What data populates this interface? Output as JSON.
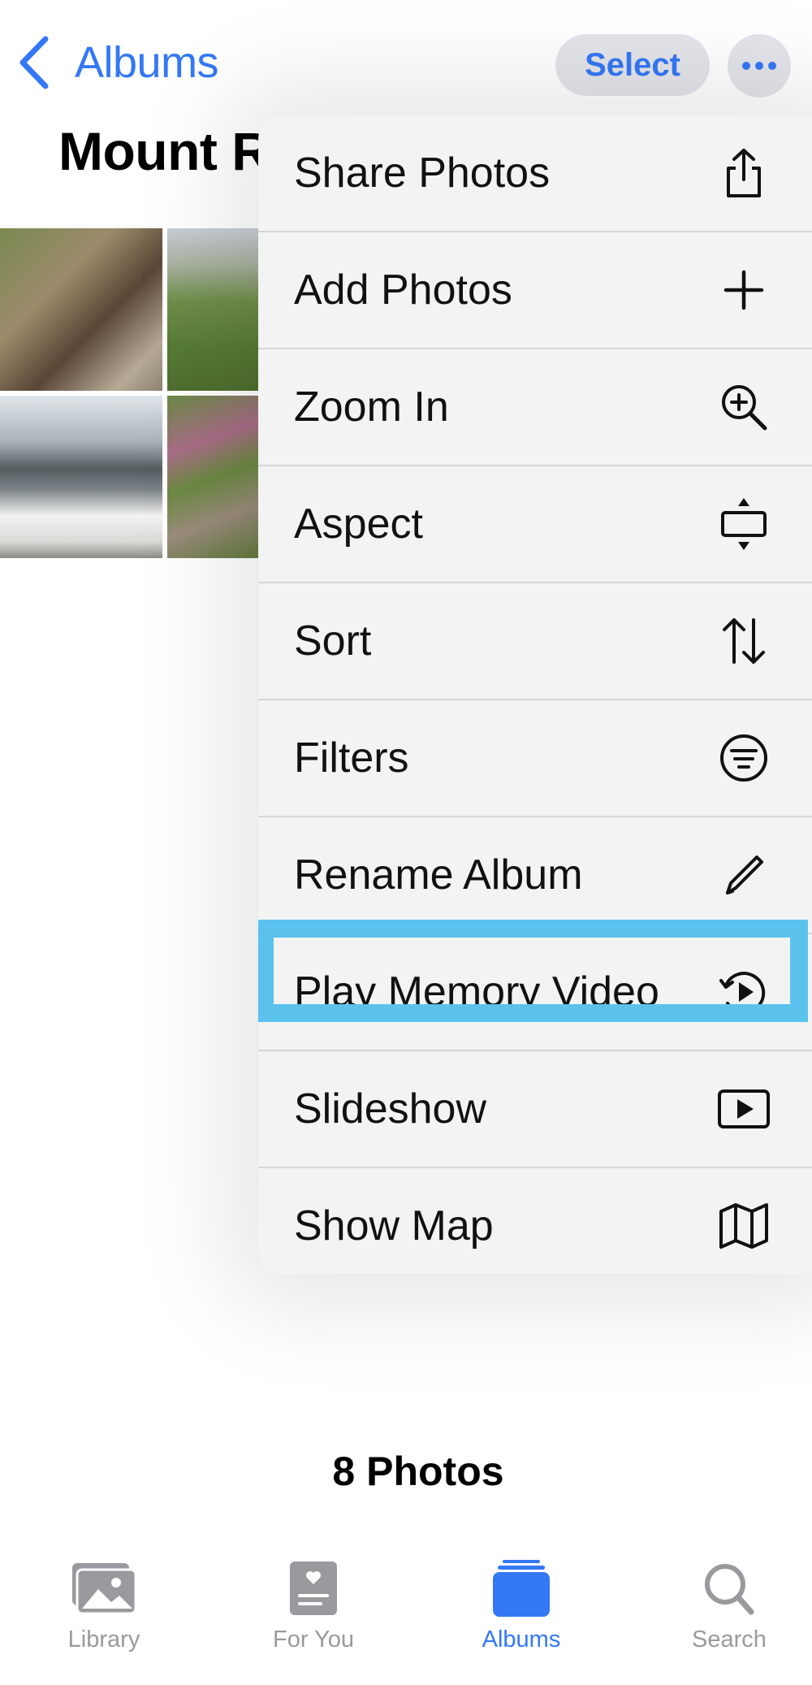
{
  "header": {
    "back_label": "Albums",
    "select_label": "Select",
    "album_title": "Mount R"
  },
  "menu": {
    "items": [
      {
        "label": "Share Photos",
        "icon": "share-icon"
      },
      {
        "label": "Add Photos",
        "icon": "plus-icon"
      },
      {
        "label": "Zoom In",
        "icon": "zoom-in-icon"
      },
      {
        "label": "Aspect",
        "icon": "aspect-icon"
      },
      {
        "label": "Sort",
        "icon": "sort-icon"
      },
      {
        "label": "Filters",
        "icon": "filters-icon"
      },
      {
        "label": "Rename Album",
        "icon": "pencil-icon"
      },
      {
        "label": "Play Memory Video",
        "icon": "memory-video-icon",
        "highlighted": true
      },
      {
        "label": "Slideshow",
        "icon": "slideshow-icon"
      },
      {
        "label": "Show Map",
        "icon": "map-icon"
      }
    ]
  },
  "footer": {
    "photo_count": "8 Photos"
  },
  "tabbar": {
    "tabs": [
      {
        "label": "Library",
        "icon": "library-icon"
      },
      {
        "label": "For You",
        "icon": "for-you-icon"
      },
      {
        "label": "Albums",
        "icon": "albums-icon",
        "active": true
      },
      {
        "label": "Search",
        "icon": "search-icon"
      }
    ]
  },
  "colors": {
    "accent": "#3478f6",
    "highlight": "#5bc2ee",
    "menu_bg": "#f3f3f3",
    "inactive_tab": "#9a9a9e"
  }
}
